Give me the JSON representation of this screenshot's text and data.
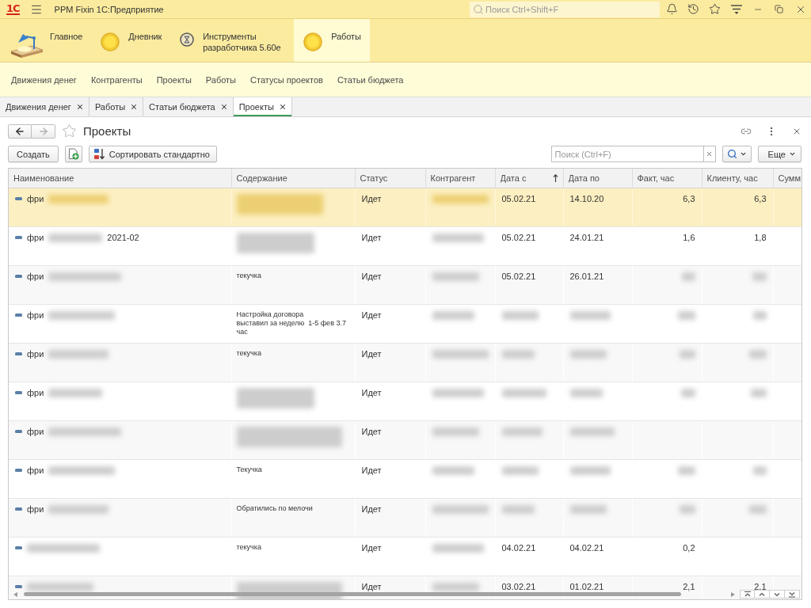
{
  "app": {
    "logo": "1С",
    "title": "PPM Fixin 1С:Предприятие",
    "search": {
      "placeholder": "Поиск Ctrl+Shift+F"
    }
  },
  "sections": [
    {
      "label": "Главное",
      "kind": "lamp",
      "selected": false
    },
    {
      "label": "Дневник",
      "kind": "circle",
      "selected": false
    },
    {
      "label": "Инструменты разработчика 5.60е",
      "kind": "tools",
      "selected": false
    },
    {
      "label": "Работы",
      "kind": "circle",
      "selected": true
    }
  ],
  "nav_links": [
    "Движения денег",
    "Контрагенты",
    "Проекты",
    "Работы",
    "Статусы проектов",
    "Статьи бюджета"
  ],
  "open_tabs": [
    {
      "label": "Движения денег",
      "selected": false
    },
    {
      "label": "Работы",
      "selected": false
    },
    {
      "label": "Статьи бюджета",
      "selected": false
    },
    {
      "label": "Проекты",
      "selected": true
    }
  ],
  "form": {
    "history": [
      {
        "kind": "back",
        "disabled": false
      },
      {
        "kind": "forward",
        "disabled": true
      }
    ],
    "favorite": false,
    "title": "Проекты",
    "toolbar": {
      "create": "Создать",
      "sort": "Сортировать стандартно",
      "search": {
        "placeholder": "Поиск (Ctrl+F)"
      },
      "more": "Еще"
    }
  },
  "table": {
    "columns": [
      {
        "label": "Наименование",
        "kind": "text",
        "sorted": false
      },
      {
        "label": "Содержание",
        "kind": "text",
        "sorted": false
      },
      {
        "label": "Статус",
        "kind": "text",
        "sorted": false
      },
      {
        "label": "Контрагент",
        "kind": "text",
        "sorted": false
      },
      {
        "label": "Дата с",
        "kind": "text",
        "sorted": true
      },
      {
        "label": "Дата по",
        "kind": "text",
        "sorted": false
      },
      {
        "label": "Факт, час",
        "kind": "number",
        "sorted": false
      },
      {
        "label": "Клиенту, час",
        "kind": "number",
        "sorted": false
      },
      {
        "label": "Сумм",
        "kind": "number",
        "sorted": false
      }
    ],
    "rows": [
      {
        "selected": true,
        "cells": [
          [
            {
              "kind": "text",
              "text": "фри"
            },
            {
              "kind": "blur"
            }
          ],
          [
            {
              "kind": "blur"
            }
          ],
          [
            {
              "kind": "text",
              "text": "Идет"
            }
          ],
          [
            {
              "kind": "blur"
            }
          ],
          [
            {
              "kind": "text",
              "text": "05.02.21"
            }
          ],
          [
            {
              "kind": "text",
              "text": "14.10.20"
            }
          ],
          [
            {
              "kind": "text",
              "text": "6,3"
            }
          ],
          [
            {
              "kind": "text",
              "text": "6,3"
            }
          ]
        ]
      },
      {
        "selected": false,
        "cells": [
          [
            {
              "kind": "text",
              "text": "фри"
            },
            {
              "kind": "blur"
            },
            {
              "kind": "text",
              "text": "2021-02"
            }
          ],
          [
            {
              "kind": "blur"
            }
          ],
          [
            {
              "kind": "text",
              "text": "Идет"
            }
          ],
          [
            {
              "kind": "blur"
            }
          ],
          [
            {
              "kind": "text",
              "text": "05.02.21"
            }
          ],
          [
            {
              "kind": "text",
              "text": "24.01.21"
            }
          ],
          [
            {
              "kind": "text",
              "text": "1,6"
            }
          ],
          [
            {
              "kind": "text",
              "text": "1,8"
            }
          ]
        ]
      },
      {
        "selected": false,
        "cells": [
          [
            {
              "kind": "text",
              "text": "фри"
            },
            {
              "kind": "blur"
            }
          ],
          [
            {
              "kind": "text",
              "text": "текучка"
            }
          ],
          [
            {
              "kind": "text",
              "text": "Идет"
            }
          ],
          [
            {
              "kind": "blur"
            }
          ],
          [
            {
              "kind": "text",
              "text": "05.02.21"
            }
          ],
          [
            {
              "kind": "text",
              "text": "26.01.21"
            }
          ],
          [
            {
              "kind": "blur"
            }
          ],
          [
            {
              "kind": "blur"
            }
          ]
        ]
      },
      {
        "selected": false,
        "cells": [
          [
            {
              "kind": "text",
              "text": "фри"
            },
            {
              "kind": "blur"
            }
          ],
          [
            {
              "kind": "text",
              "text": "Настройка договора\nвыставил за неделю  1-5 фев 3.7 час"
            }
          ],
          [
            {
              "kind": "text",
              "text": "Идет"
            }
          ],
          [
            {
              "kind": "blur"
            }
          ],
          [
            {
              "kind": "blur"
            }
          ],
          [
            {
              "kind": "blur"
            }
          ],
          [
            {
              "kind": "blur"
            }
          ],
          [
            {
              "kind": "blur"
            }
          ]
        ]
      },
      {
        "selected": false,
        "cells": [
          [
            {
              "kind": "text",
              "text": "фри"
            },
            {
              "kind": "blur"
            }
          ],
          [
            {
              "kind": "text",
              "text": "текучка"
            }
          ],
          [
            {
              "kind": "text",
              "text": "Идет"
            }
          ],
          [
            {
              "kind": "blur"
            }
          ],
          [
            {
              "kind": "blur"
            }
          ],
          [
            {
              "kind": "blur"
            }
          ],
          [
            {
              "kind": "blur"
            }
          ],
          [
            {
              "kind": "blur"
            }
          ]
        ]
      },
      {
        "selected": false,
        "cells": [
          [
            {
              "kind": "text",
              "text": "фри"
            },
            {
              "kind": "blur"
            }
          ],
          [
            {
              "kind": "blur"
            }
          ],
          [
            {
              "kind": "text",
              "text": "Идет"
            }
          ],
          [
            {
              "kind": "blur"
            }
          ],
          [
            {
              "kind": "blur"
            }
          ],
          [
            {
              "kind": "blur"
            }
          ],
          [
            {
              "kind": "blur"
            }
          ],
          [
            {
              "kind": "blur"
            }
          ]
        ]
      },
      {
        "selected": false,
        "cells": [
          [
            {
              "kind": "text",
              "text": "фри"
            },
            {
              "kind": "blur"
            }
          ],
          [
            {
              "kind": "blur"
            }
          ],
          [
            {
              "kind": "text",
              "text": "Идет"
            }
          ],
          [
            {
              "kind": "blur"
            }
          ],
          [
            {
              "kind": "blur"
            }
          ],
          [
            {
              "kind": "blur"
            }
          ]
        ]
      },
      {
        "selected": false,
        "cells": [
          [
            {
              "kind": "text",
              "text": "фри"
            },
            {
              "kind": "blur"
            }
          ],
          [
            {
              "kind": "text",
              "text": "Текучка"
            }
          ],
          [
            {
              "kind": "text",
              "text": "Идет"
            }
          ],
          [
            {
              "kind": "blur"
            }
          ],
          [
            {
              "kind": "blur"
            }
          ],
          [
            {
              "kind": "blur"
            }
          ],
          [
            {
              "kind": "blur"
            }
          ],
          [
            {
              "kind": "blur"
            }
          ]
        ]
      },
      {
        "selected": false,
        "cells": [
          [
            {
              "kind": "text",
              "text": "фри"
            },
            {
              "kind": "blur"
            }
          ],
          [
            {
              "kind": "text",
              "text": "Обратились по мелочи"
            }
          ],
          [
            {
              "kind": "text",
              "text": "Идет"
            }
          ],
          [
            {
              "kind": "blur"
            }
          ],
          [
            {
              "kind": "blur"
            }
          ],
          [
            {
              "kind": "blur"
            }
          ],
          [
            {
              "kind": "blur"
            }
          ],
          [
            {
              "kind": "blur"
            }
          ]
        ]
      },
      {
        "selected": false,
        "cells": [
          [
            {
              "kind": "blur"
            }
          ],
          [
            {
              "kind": "text",
              "text": "текучка"
            }
          ],
          [
            {
              "kind": "text",
              "text": "Идет"
            }
          ],
          [
            {
              "kind": "blur"
            }
          ],
          [
            {
              "kind": "text",
              "text": "04.02.21"
            }
          ],
          [
            {
              "kind": "text",
              "text": "04.02.21"
            }
          ],
          [
            {
              "kind": "text",
              "text": "0,2"
            }
          ]
        ]
      },
      {
        "selected": false,
        "cells": [
          [
            {
              "kind": "blur"
            }
          ],
          [
            {
              "kind": "blur"
            }
          ],
          [
            {
              "kind": "text",
              "text": "Идет"
            }
          ],
          [
            {
              "kind": "blur"
            }
          ],
          [
            {
              "kind": "text",
              "text": "03.02.21"
            }
          ],
          [
            {
              "kind": "text",
              "text": "01.02.21"
            }
          ],
          [
            {
              "kind": "text",
              "text": "2,1"
            }
          ],
          [
            {
              "kind": "text",
              "text": "2,1"
            }
          ]
        ]
      }
    ]
  }
}
